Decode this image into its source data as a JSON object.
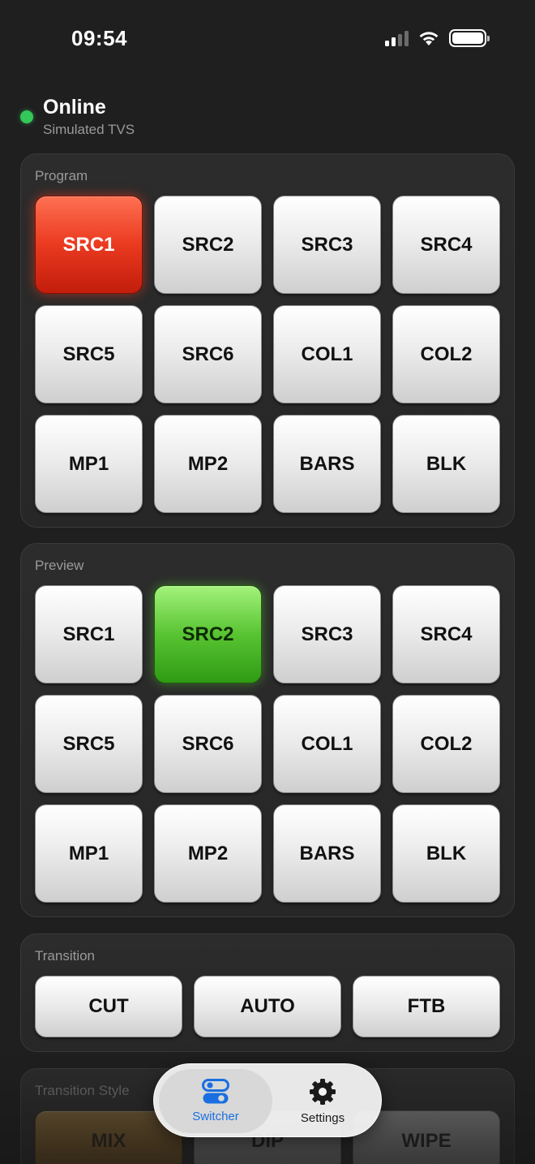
{
  "status_bar": {
    "time": "09:54"
  },
  "connection": {
    "state": "Online",
    "subtitle": "Simulated TVS",
    "dot_color": "#34c759"
  },
  "program": {
    "title": "Program",
    "keys": [
      "SRC1",
      "SRC2",
      "SRC3",
      "SRC4",
      "SRC5",
      "SRC6",
      "COL1",
      "COL2",
      "MP1",
      "MP2",
      "BARS",
      "BLK"
    ],
    "active": "SRC1",
    "active_color": "#ea3a20"
  },
  "preview": {
    "title": "Preview",
    "keys": [
      "SRC1",
      "SRC2",
      "SRC3",
      "SRC4",
      "SRC5",
      "SRC6",
      "COL1",
      "COL2",
      "MP1",
      "MP2",
      "BARS",
      "BLK"
    ],
    "active": "SRC2",
    "active_color": "#58c432"
  },
  "transition": {
    "title": "Transition",
    "buttons": [
      "CUT",
      "AUTO",
      "FTB"
    ]
  },
  "transition_style": {
    "title": "Transition Style",
    "buttons": [
      "MIX",
      "DIP",
      "WIPE"
    ],
    "active": "MIX"
  },
  "tabbar": {
    "tabs": [
      {
        "label": "Switcher",
        "icon": "toggle-switches-icon",
        "active": true
      },
      {
        "label": "Settings",
        "icon": "gear-icon",
        "active": false
      }
    ],
    "active_color": "#1a6fe0"
  }
}
